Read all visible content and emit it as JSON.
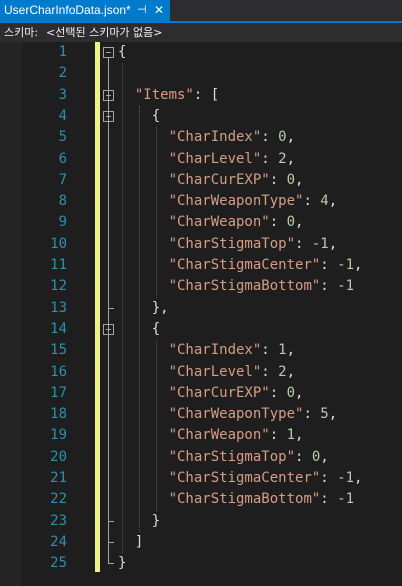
{
  "tab": {
    "title": "UserCharInfoData.json*",
    "pin_icon": "⊣",
    "close_icon": "✕"
  },
  "schema": {
    "label": "스키마:",
    "value": "<선택된 스키마가 없음>"
  },
  "colors": {
    "accent": "#007acc",
    "line_number": "#2b91af",
    "string": "#d69d85",
    "number": "#b5cea8",
    "change_bar": "#eff086"
  },
  "editor": {
    "line_numbers": [
      "1",
      "2",
      "3",
      "4",
      "5",
      "6",
      "7",
      "8",
      "9",
      "10",
      "11",
      "12",
      "13",
      "14",
      "15",
      "16",
      "17",
      "18",
      "19",
      "20",
      "21",
      "22",
      "23",
      "24",
      "25"
    ],
    "lines": [
      {
        "indent": "",
        "key": "",
        "sep": "{",
        "val": "",
        "tail": ""
      },
      {
        "indent": "",
        "key": "",
        "sep": "",
        "val": "",
        "tail": ""
      },
      {
        "indent": "  ",
        "key": "\"Items\"",
        "sep": ": [",
        "val": "",
        "tail": ""
      },
      {
        "indent": "    ",
        "key": "",
        "sep": "{",
        "val": "",
        "tail": ""
      },
      {
        "indent": "      ",
        "key": "\"CharIndex\"",
        "sep": ": ",
        "val": "0",
        "tail": ","
      },
      {
        "indent": "      ",
        "key": "\"CharLevel\"",
        "sep": ": ",
        "val": "2",
        "tail": ","
      },
      {
        "indent": "      ",
        "key": "\"CharCurEXP\"",
        "sep": ": ",
        "val": "0",
        "tail": ","
      },
      {
        "indent": "      ",
        "key": "\"CharWeaponType\"",
        "sep": ": ",
        "val": "4",
        "tail": ","
      },
      {
        "indent": "      ",
        "key": "\"CharWeapon\"",
        "sep": ": ",
        "val": "0",
        "tail": ","
      },
      {
        "indent": "      ",
        "key": "\"CharStigmaTop\"",
        "sep": ": ",
        "val": "-1",
        "tail": ","
      },
      {
        "indent": "      ",
        "key": "\"CharStigmaCenter\"",
        "sep": ": ",
        "val": "-1",
        "tail": ","
      },
      {
        "indent": "      ",
        "key": "\"CharStigmaBottom\"",
        "sep": ": ",
        "val": "-1",
        "tail": ""
      },
      {
        "indent": "    ",
        "key": "",
        "sep": "},",
        "val": "",
        "tail": ""
      },
      {
        "indent": "    ",
        "key": "",
        "sep": "{",
        "val": "",
        "tail": ""
      },
      {
        "indent": "      ",
        "key": "\"CharIndex\"",
        "sep": ": ",
        "val": "1",
        "tail": ","
      },
      {
        "indent": "      ",
        "key": "\"CharLevel\"",
        "sep": ": ",
        "val": "2",
        "tail": ","
      },
      {
        "indent": "      ",
        "key": "\"CharCurEXP\"",
        "sep": ": ",
        "val": "0",
        "tail": ","
      },
      {
        "indent": "      ",
        "key": "\"CharWeaponType\"",
        "sep": ": ",
        "val": "5",
        "tail": ","
      },
      {
        "indent": "      ",
        "key": "\"CharWeapon\"",
        "sep": ": ",
        "val": "1",
        "tail": ","
      },
      {
        "indent": "      ",
        "key": "\"CharStigmaTop\"",
        "sep": ": ",
        "val": "0",
        "tail": ","
      },
      {
        "indent": "      ",
        "key": "\"CharStigmaCenter\"",
        "sep": ": ",
        "val": "-1",
        "tail": ","
      },
      {
        "indent": "      ",
        "key": "\"CharStigmaBottom\"",
        "sep": ": ",
        "val": "-1",
        "tail": ""
      },
      {
        "indent": "    ",
        "key": "",
        "sep": "}",
        "val": "",
        "tail": ""
      },
      {
        "indent": "  ",
        "key": "",
        "sep": "]",
        "val": "",
        "tail": ""
      },
      {
        "indent": "",
        "key": "",
        "sep": "}",
        "val": "",
        "tail": ""
      }
    ]
  }
}
